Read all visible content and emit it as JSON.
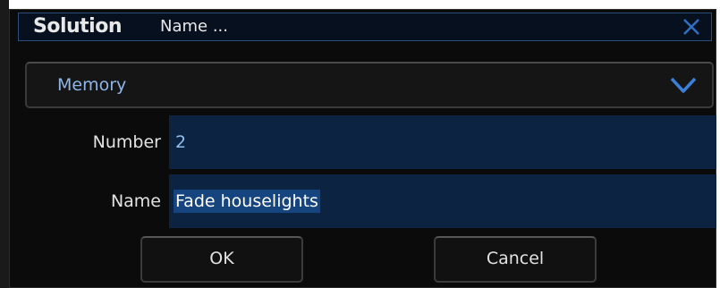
{
  "dialog": {
    "brand": "Solution",
    "title": "Name ...",
    "close_icon": "close-x-icon"
  },
  "type_select": {
    "selected": "Memory",
    "icon": "chevron-down-icon"
  },
  "fields": {
    "number_label": "Number",
    "number_value": "2",
    "name_label": "Name",
    "name_value": "Fade houselights"
  },
  "buttons": {
    "ok_label": "OK",
    "cancel_label": "Cancel"
  },
  "colors": {
    "background": "#0b0b0b",
    "title_border": "#2a4e7c",
    "input_bg": "#0c2442",
    "selection": "#16447e",
    "accent_text": "#8fb6e6"
  }
}
